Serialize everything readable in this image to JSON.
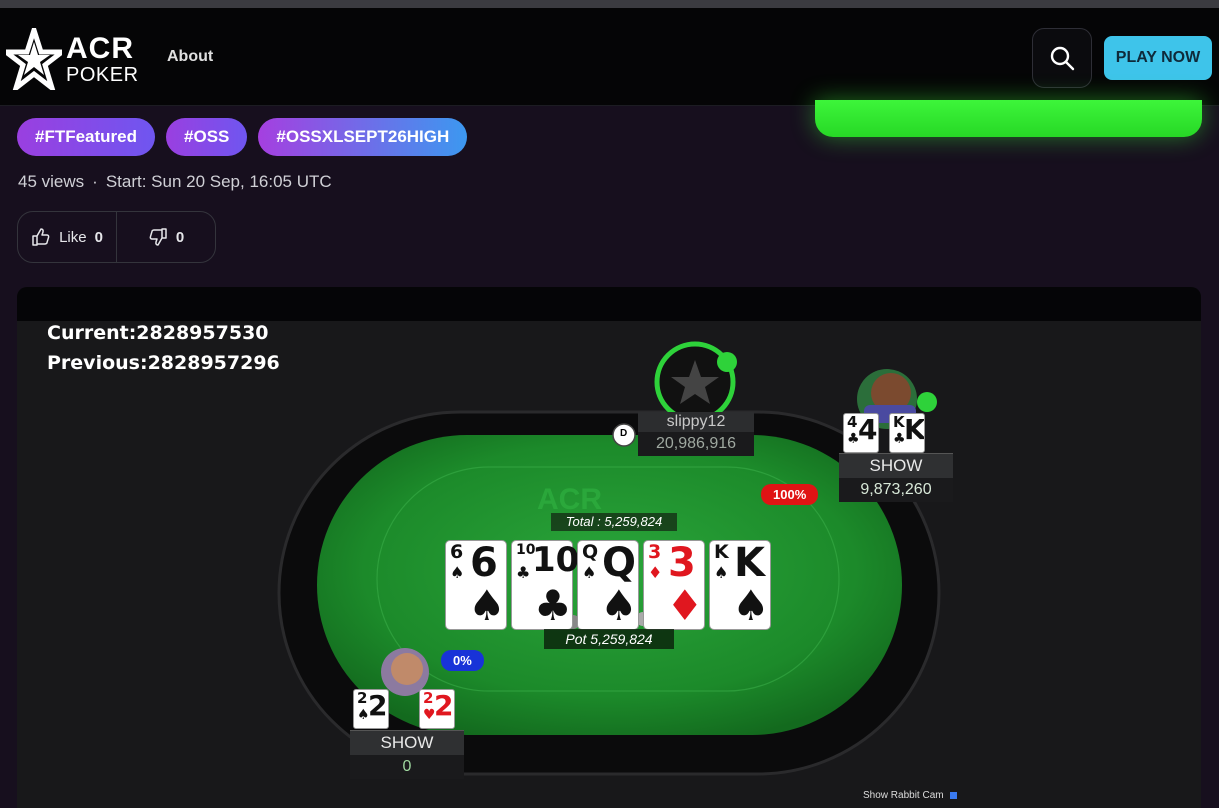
{
  "nav": {
    "logo_line1": "ACR",
    "logo_line2": "POKER",
    "about_label": "About",
    "play_label": "PLAY NOW"
  },
  "tags": [
    "#FTFeatured",
    "#OSS",
    "#OSSXLSEPT26HIGH"
  ],
  "meta": {
    "views": "45 views",
    "start": "Start: Sun 20 Sep, 16:05 UTC"
  },
  "votes": {
    "like_label": "Like",
    "like_count": "0",
    "dislike_count": "0"
  },
  "video": {
    "current": "Current:2828957530",
    "previous": "Previous:2828957296",
    "total": "Total : 5,259,824",
    "pot": "Pot  5,259,824",
    "table_logo": "ACR",
    "dealer_button": "D",
    "rabbit_cam": "Show Rabbit Cam",
    "players": {
      "top": {
        "name": "slippy12",
        "stack": "20,986,916"
      },
      "right": {
        "status": "SHOW",
        "stack": "9,873,260",
        "equity": "100%",
        "cards": [
          {
            "rank": "4",
            "suit": "♣"
          },
          {
            "rank": "K",
            "suit": "♣"
          }
        ]
      },
      "bottom": {
        "status": "SHOW",
        "stack": "0",
        "equity": "0%",
        "cards": [
          {
            "rank": "2",
            "suit": "♠"
          },
          {
            "rank": "2",
            "suit": "♥"
          }
        ]
      }
    },
    "board": [
      {
        "rank": "6",
        "suit": "♠",
        "color": "#111111"
      },
      {
        "rank": "10",
        "suit": "♣",
        "color": "#111111"
      },
      {
        "rank": "Q",
        "suit": "♠",
        "color": "#111111"
      },
      {
        "rank": "3",
        "suit": "♦",
        "color": "#e0171f"
      },
      {
        "rank": "K",
        "suit": "♠",
        "color": "#111111"
      }
    ]
  },
  "colors": {
    "accent_play": "#3ec4ea",
    "tag_gradient_start": "#9a3fe0",
    "banner_green": "#3df53a",
    "felt": "#1f8a2c"
  }
}
